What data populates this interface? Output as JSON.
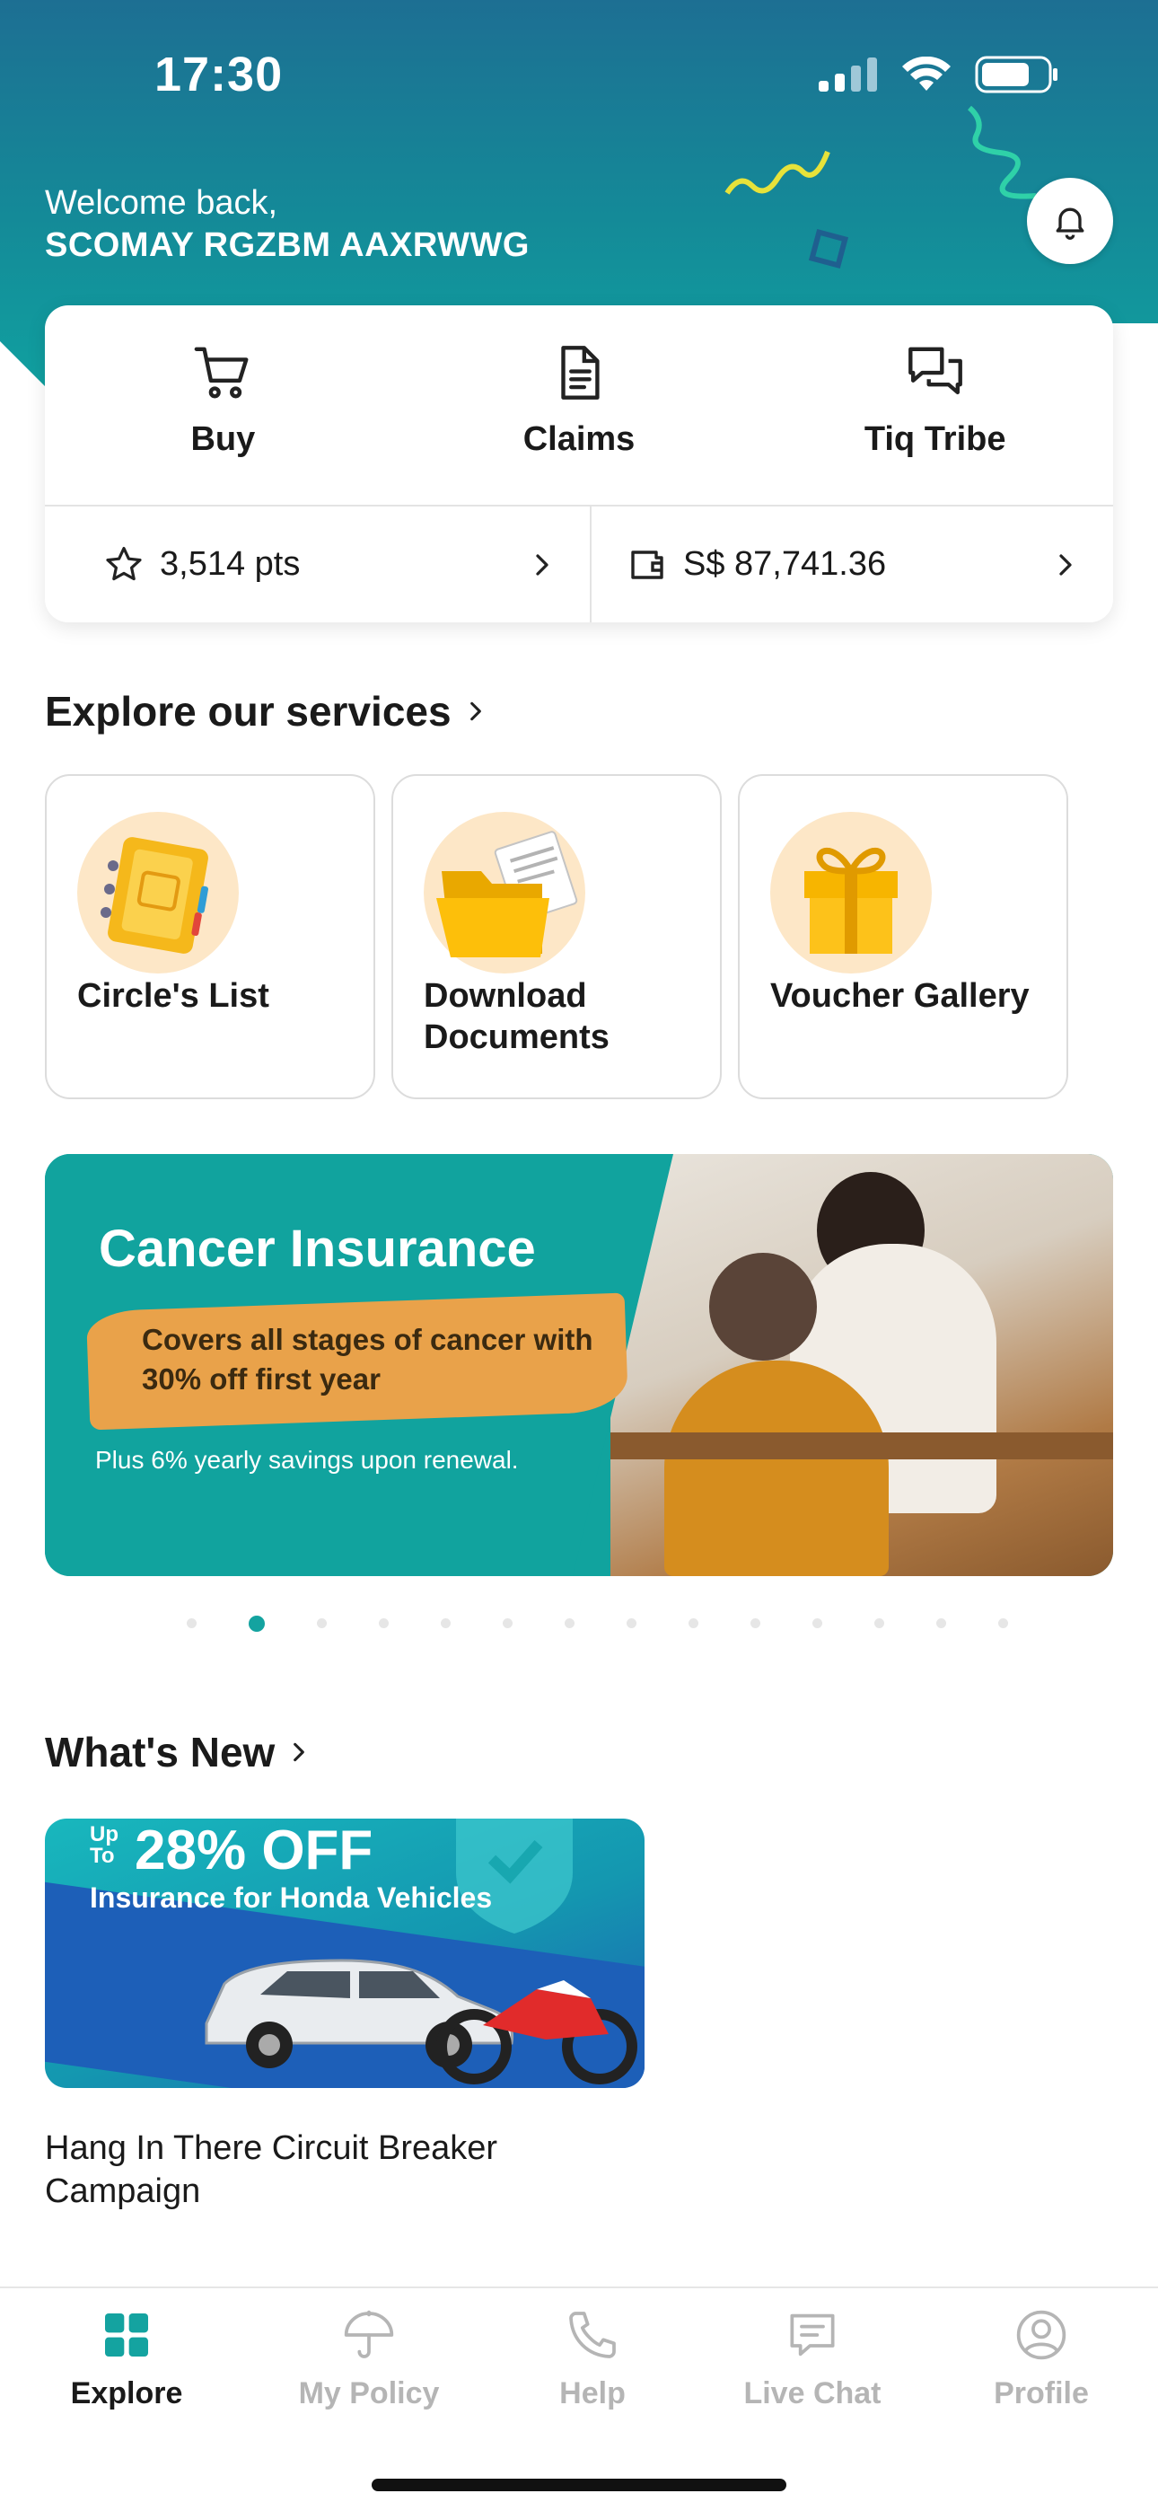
{
  "status_bar": {
    "time": "17:30"
  },
  "header": {
    "welcome": "Welcome back,",
    "user_name": "SCOMAY RGZBM AAXRWWG",
    "colors": {
      "gradient_top": "#1d6f93",
      "gradient_bottom": "#10a1a0"
    }
  },
  "actions": [
    {
      "label": "Buy",
      "icon": "cart-icon"
    },
    {
      "label": "Claims",
      "icon": "document-icon"
    },
    {
      "label": "Tiq Tribe",
      "icon": "chat-bubbles-icon"
    }
  ],
  "stats": {
    "points": "3,514 pts",
    "wallet": "S$ 87,741.36"
  },
  "services": {
    "title": "Explore our services",
    "items": [
      {
        "label": "Circle's List",
        "icon": "notebook-icon"
      },
      {
        "label": "Download Documents",
        "icon": "folder-icon"
      },
      {
        "label": "Voucher Gallery",
        "icon": "gift-icon"
      }
    ]
  },
  "banner": {
    "title": "Cancer Insurance",
    "highlight": "Covers all stages of cancer with 30% off first year",
    "note": "Plus 6% yearly savings upon renewal.",
    "carousel_total": 14,
    "carousel_active": 2,
    "accent": "#11a39e"
  },
  "whats_new": {
    "title": "What's New",
    "card": {
      "upto": "Up To",
      "discount": "28% OFF",
      "line": "Insurance for Honda Vehicles"
    },
    "caption": "Hang In There Circuit Breaker Campaign"
  },
  "bottom_nav": {
    "items": [
      {
        "label": "Explore",
        "icon": "grid-icon",
        "active": true
      },
      {
        "label": "My Policy",
        "icon": "umbrella-icon",
        "active": false
      },
      {
        "label": "Help",
        "icon": "phone-icon",
        "active": false
      },
      {
        "label": "Live Chat",
        "icon": "chat-icon",
        "active": false
      },
      {
        "label": "Profile",
        "icon": "profile-icon",
        "active": false
      }
    ],
    "active_color": "#14a3a0"
  }
}
